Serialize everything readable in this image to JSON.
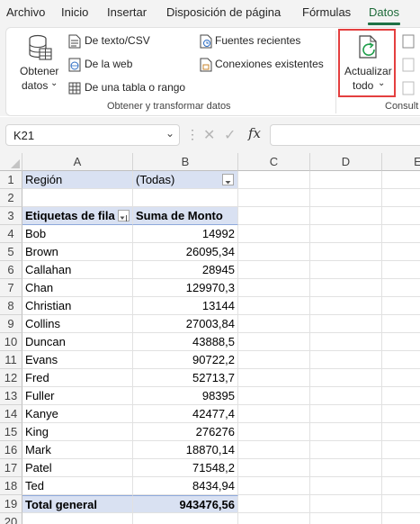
{
  "menu": {
    "tabs": [
      "Archivo",
      "Inicio",
      "Insertar",
      "Disposición de página",
      "Fórmulas",
      "Datos"
    ],
    "active": "Datos"
  },
  "ribbon": {
    "obtener_l1": "Obtener",
    "obtener_l2": "datos",
    "desde_texto": "De texto/CSV",
    "de_la_web": "De la web",
    "de_tabla": "De una tabla o rango",
    "fuentes_recientes": "Fuentes recientes",
    "conexiones": "Conexiones existentes",
    "group_label": "Obtener y transformar datos",
    "actualizar_l1": "Actualizar",
    "actualizar_l2": "todo",
    "consultas_label": "Consult"
  },
  "formula_bar": {
    "name_box": "K21",
    "fx": "fx",
    "value": ""
  },
  "grid": {
    "columns": [
      "A",
      "B",
      "C",
      "D",
      "E"
    ],
    "rows": [
      "1",
      "2",
      "3",
      "4",
      "5",
      "6",
      "7",
      "8",
      "9",
      "10",
      "11",
      "12",
      "13",
      "14",
      "15",
      "16",
      "17",
      "18",
      "19",
      "20"
    ],
    "filter_label": "Región",
    "filter_value": "(Todas)",
    "header_row_label": "Etiquetas de fila",
    "header_value_label": "Suma de Monto",
    "data": [
      {
        "name": "Bob",
        "value": "14992"
      },
      {
        "name": "Brown",
        "value": "26095,34"
      },
      {
        "name": "Callahan",
        "value": "28945"
      },
      {
        "name": "Chan",
        "value": "129970,3"
      },
      {
        "name": "Christian",
        "value": "13144"
      },
      {
        "name": "Collins",
        "value": "27003,84"
      },
      {
        "name": "Duncan",
        "value": "43888,5"
      },
      {
        "name": "Evans",
        "value": "90722,2"
      },
      {
        "name": "Fred",
        "value": "52713,7"
      },
      {
        "name": "Fuller",
        "value": "98395"
      },
      {
        "name": "Kanye",
        "value": "42477,4"
      },
      {
        "name": "King",
        "value": "276276"
      },
      {
        "name": "Mark",
        "value": "18870,14"
      },
      {
        "name": "Patel",
        "value": "71548,2"
      },
      {
        "name": "Ted",
        "value": "8434,94"
      }
    ],
    "total_label": "Total general",
    "total_value": "943476,56"
  },
  "colors": {
    "pivot_header": "#d9e1f2",
    "highlight": "#e43f3f",
    "accent": "#1e7145"
  }
}
